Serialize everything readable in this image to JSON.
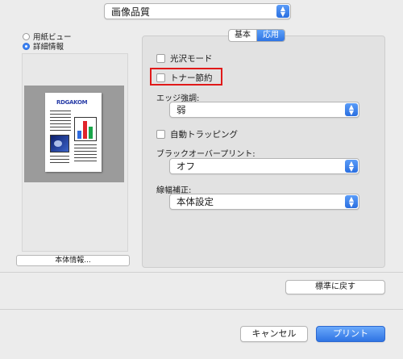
{
  "category_popup": {
    "value": "画像品質"
  },
  "preview_mode": {
    "options": [
      {
        "label": "用紙ビュー",
        "selected": false
      },
      {
        "label": "詳細情報",
        "selected": true
      }
    ]
  },
  "preview": {
    "page_title": "RDGAKOM"
  },
  "device_info_button": "本体情報...",
  "tabs": [
    {
      "label": "基本",
      "active": false
    },
    {
      "label": "応用",
      "active": true
    }
  ],
  "options": {
    "glossy_mode": {
      "label": "光沢モード",
      "checked": false
    },
    "toner_save": {
      "label": "トナー節約",
      "checked": false
    },
    "edge_enhance": {
      "label": "エッジ強調:",
      "value": "弱"
    },
    "auto_trapping": {
      "label": "自動トラッピング",
      "checked": false
    },
    "black_overprint": {
      "label": "ブラックオーバープリント:",
      "value": "オフ"
    },
    "line_width": {
      "label": "線幅補正:",
      "value": "本体設定"
    }
  },
  "restore_defaults_button": "標準に戻す",
  "cancel_button": "キャンセル",
  "print_button": "プリント",
  "colors": {
    "accent": "#2f74e3",
    "highlight": "#e01919"
  }
}
